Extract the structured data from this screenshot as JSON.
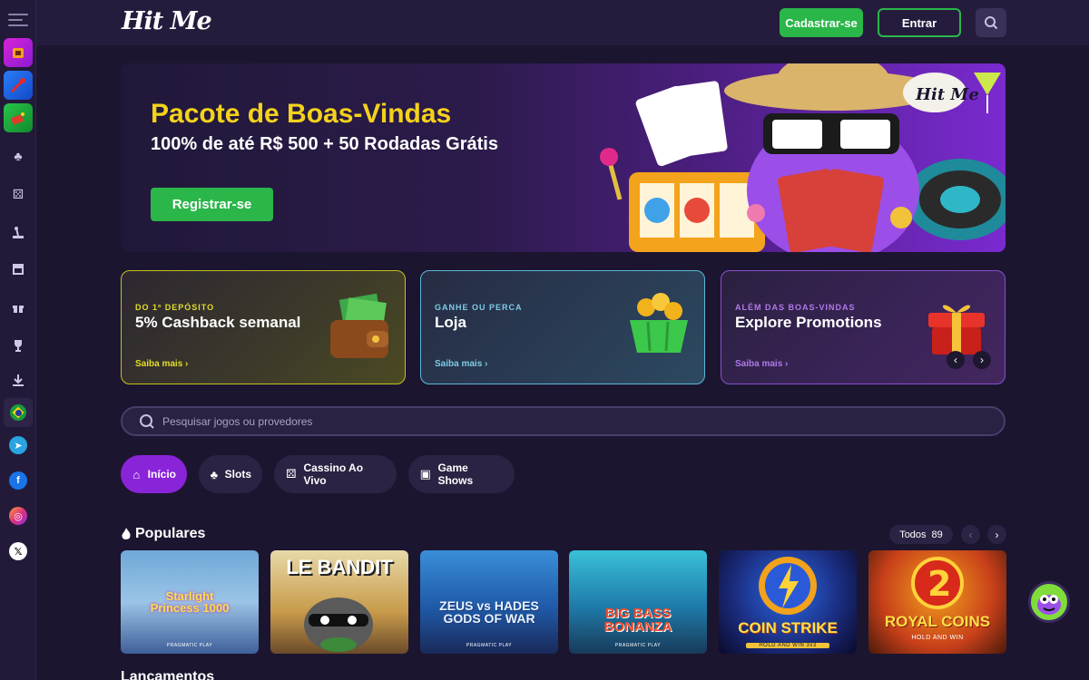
{
  "header": {
    "logo": "Hit Me",
    "signup_label": "Cadastrar-se",
    "login_label": "Entrar"
  },
  "sidebar": {
    "items": [
      {
        "name": "menu-icon"
      },
      {
        "name": "promo-tile-1",
        "color": "#c21fd0"
      },
      {
        "name": "promo-tile-2",
        "color": "#1b6cf0"
      },
      {
        "name": "promo-tile-3",
        "color": "#1fa83a"
      },
      {
        "name": "casino-icon"
      },
      {
        "name": "live-casino-icon"
      },
      {
        "name": "game-shows-icon"
      },
      {
        "name": "store-icon"
      },
      {
        "name": "gift-icon"
      },
      {
        "name": "trophy-icon"
      },
      {
        "name": "download-icon"
      },
      {
        "name": "brazil-flag-icon"
      },
      {
        "name": "telegram-icon"
      },
      {
        "name": "facebook-icon"
      },
      {
        "name": "instagram-icon"
      },
      {
        "name": "x-icon"
      }
    ]
  },
  "hero": {
    "title": "Pacote de Boas-Vindas",
    "subtitle": "100% de até R$ 500 + 50 Rodadas Grátis",
    "button": "Registrar-se",
    "badge": "Hit Me"
  },
  "promos": [
    {
      "kicker": "DO 1º DEPÓSITO",
      "title": "5% Cashback semanal",
      "link": "Saiba mais ›"
    },
    {
      "kicker": "GANHE OU PERCA",
      "title": "Loja",
      "link": "Saiba mais ›"
    },
    {
      "kicker": "ALÉM DAS BOAS-VINDAS",
      "title": "Explore Promotions",
      "link": "Saiba mais ›"
    }
  ],
  "search": {
    "placeholder": "Pesquisar jogos ou provedores"
  },
  "tabs": [
    {
      "label": "Início",
      "active": true
    },
    {
      "label": "Slots",
      "active": false
    },
    {
      "label": "Cassino Ao Vivo",
      "active": false
    },
    {
      "label": "Game Shows",
      "active": false
    }
  ],
  "popular": {
    "title": "Populares",
    "see_all": "Todos",
    "count": "89"
  },
  "games": [
    {
      "name": "Starlight Princess 1000",
      "provider": "PRAGMATIC PLAY"
    },
    {
      "name": "LE BANDIT",
      "provider": ""
    },
    {
      "name": "ZEUS vs HADES GODS OF WAR",
      "provider": "PRAGMATIC PLAY"
    },
    {
      "name": "BIG BASS BONANZA",
      "provider": "PRAGMATIC PLAY"
    },
    {
      "name": "COIN STRIKE",
      "provider": "HOLD AND WIN 3x3"
    },
    {
      "name": "ROYAL COINS",
      "provider": "HOLD AND WIN"
    }
  ],
  "next_section": {
    "title": "Lançamentos"
  }
}
